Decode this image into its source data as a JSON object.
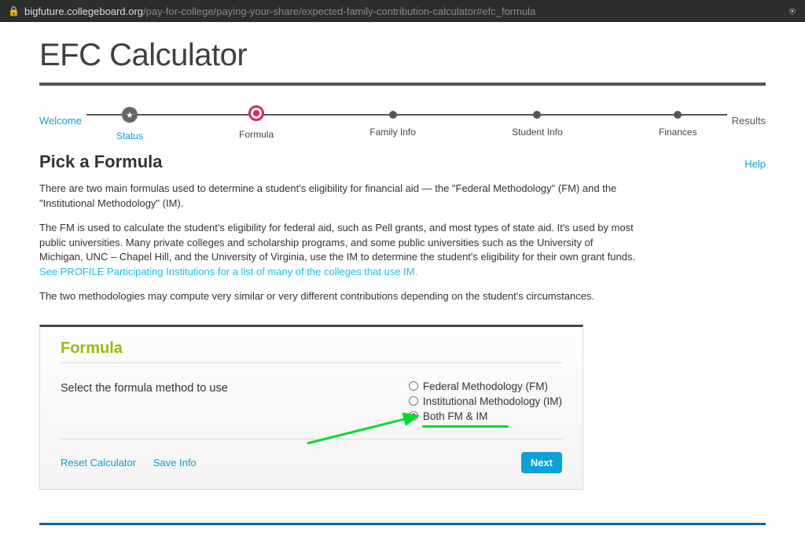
{
  "url": {
    "secure": true,
    "host": "bigfuture.collegeboard.org",
    "path": "/pay-for-college/paying-your-share/expected-family-contribution-calculator#efc_formula"
  },
  "title": "EFC Calculator",
  "progress": {
    "start": "Welcome",
    "end": "Results",
    "steps": [
      {
        "label": "Status",
        "state": "done",
        "active_label": true
      },
      {
        "label": "Formula",
        "state": "current"
      },
      {
        "label": "Family Info",
        "state": "future"
      },
      {
        "label": "Student Info",
        "state": "future"
      },
      {
        "label": "Finances",
        "state": "future"
      }
    ]
  },
  "section": {
    "heading": "Pick a Formula",
    "help": "Help"
  },
  "paras": {
    "p1": "There are two main formulas used to determine a student's eligibility for financial aid — the \"Federal Methodology\" (FM) and the \"Institutional Methodology\" (IM).",
    "p2a": "The FM is used to calculate the student's eligibility for federal aid, such as Pell grants, and most types of state aid. It's used by most public universities. Many private colleges and scholarship programs, and some public universities such as the University of Michigan, UNC – Chapel Hill, and the University of Virginia, use the IM to determine the student's eligibility for their own grant funds. ",
    "p2link": "See PROFILE Participating Institutions for a list of many of the colleges that use IM.",
    "p3": "The two methodologies may compute very similar or very different contributions depending on the student's circumstances."
  },
  "panel": {
    "title": "Formula",
    "prompt": "Select the formula method to use",
    "options": [
      {
        "label": "Federal Methodology (FM)",
        "checked": false
      },
      {
        "label": "Institutional Methodology (IM)",
        "checked": false
      },
      {
        "label": "Both FM & IM",
        "checked": true
      }
    ],
    "reset": "Reset Calculator",
    "save": "Save Info",
    "next": "Next"
  }
}
